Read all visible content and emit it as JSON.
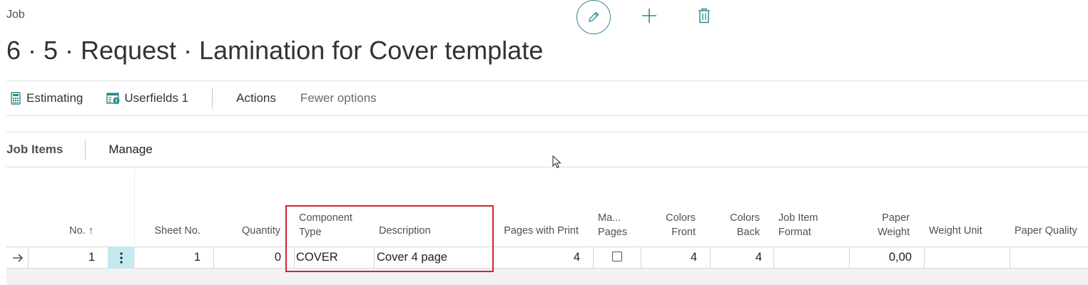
{
  "breadcrumb": "Job",
  "title": "6 · 5 · Request · Lamination for Cover template",
  "header_actions": {
    "edit_icon": "pencil-icon",
    "new_icon": "plus-icon",
    "delete_icon": "trash-icon"
  },
  "action_bar": {
    "estimating": "Estimating",
    "userfields": "Userfields 1",
    "actions": "Actions",
    "fewer_options": "Fewer options"
  },
  "part": {
    "title": "Job Items",
    "manage": "Manage"
  },
  "columns": {
    "no": "No. ↑",
    "sheet_no": "Sheet No.",
    "quantity": "Quantity",
    "component_type_1": "Component",
    "component_type_2": "Type",
    "description": "Description",
    "pages_with_print": "Pages with Print",
    "ma_pages_1": "Ma...",
    "ma_pages_2": "Pages",
    "colors_front_1": "Colors",
    "colors_front_2": "Front",
    "colors_back_1": "Colors",
    "colors_back_2": "Back",
    "job_item_format_1": "Job Item",
    "job_item_format_2": "Format",
    "paper_weight_1": "Paper",
    "paper_weight_2": "Weight",
    "weight_unit": "Weight Unit",
    "paper_quality": "Paper Quality"
  },
  "rows": [
    {
      "no": "1",
      "sheet_no": "1",
      "quantity": "0",
      "component_type": "COVER",
      "description": "Cover 4 page",
      "pages_with_print": "4",
      "manual_pages": false,
      "colors_front": "4",
      "colors_back": "4",
      "job_item_format": "",
      "paper_weight": "0,00",
      "weight_unit": "",
      "paper_quality": ""
    }
  ],
  "colors": {
    "accent": "#2f8a8d",
    "selection": "#c4e9ef",
    "highlight": "#d0272d"
  }
}
